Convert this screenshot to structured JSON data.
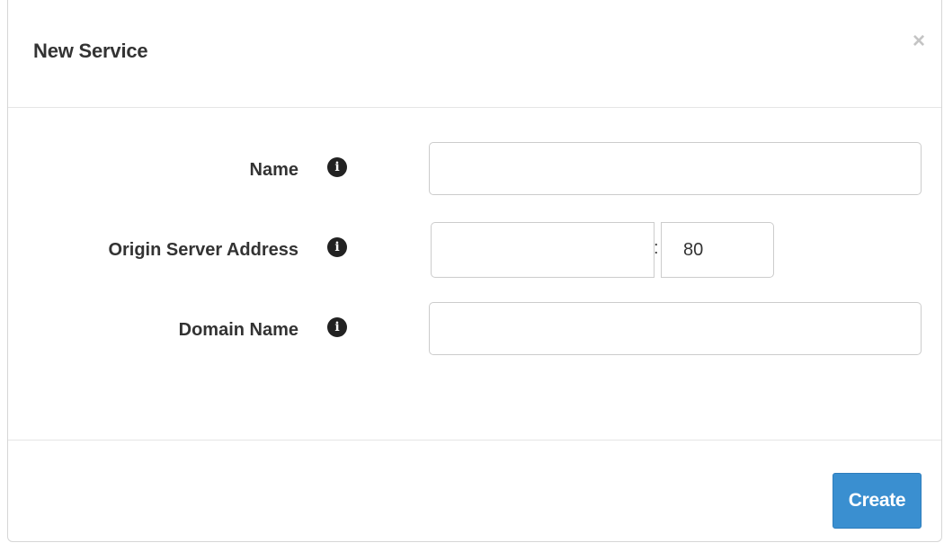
{
  "dialog": {
    "title": "New Service",
    "close_glyph": "×"
  },
  "form": {
    "name": {
      "label": "Name",
      "value": "",
      "info_icon": "info-icon"
    },
    "origin_server_address": {
      "label": "Origin Server Address",
      "host_value": "",
      "separator": ":",
      "port_value": "80",
      "info_icon": "info-icon"
    },
    "domain_name": {
      "label": "Domain Name",
      "value": "",
      "info_icon": "info-icon"
    }
  },
  "footer": {
    "create_label": "Create"
  },
  "colors": {
    "primary_button": "#3a8fd0",
    "text": "#333333",
    "border": "#cccccc"
  }
}
